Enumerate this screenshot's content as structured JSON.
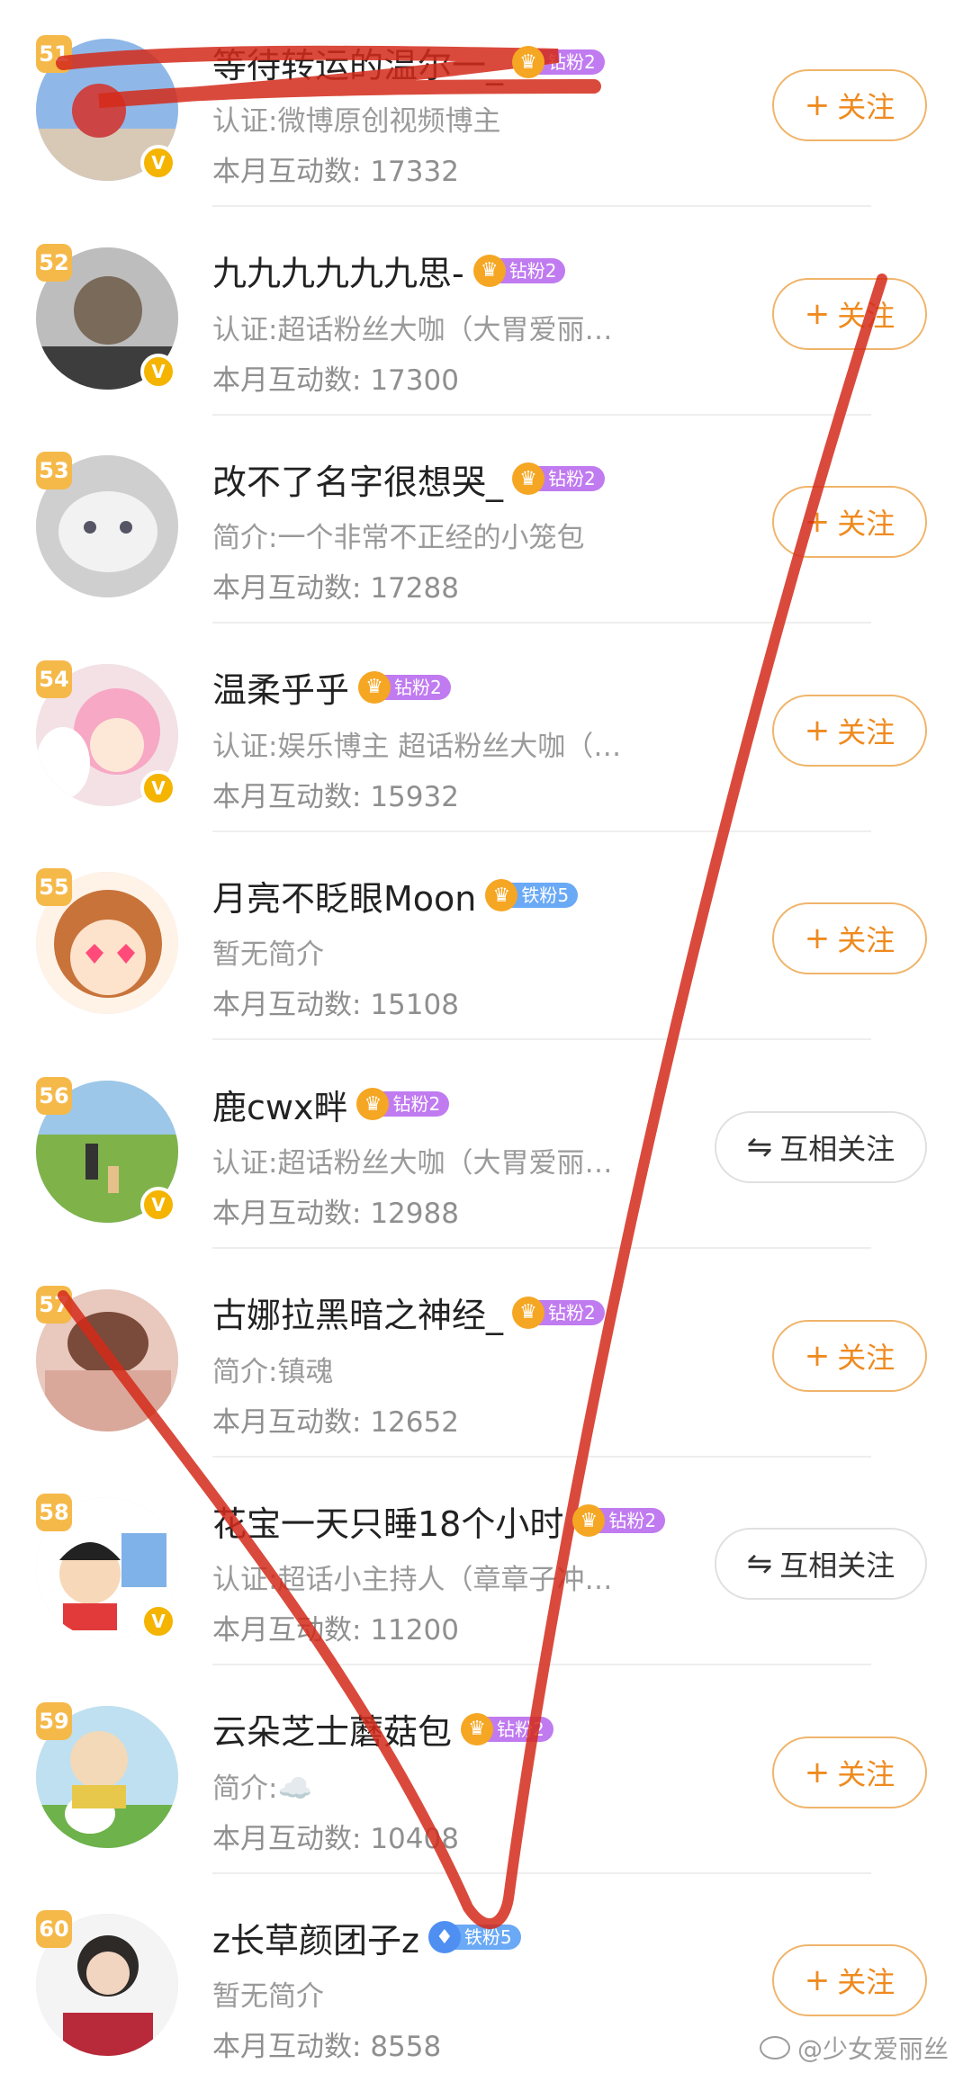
{
  "rows": [
    {
      "rank": "51",
      "name": "等待转运的温尔一_",
      "fan_level": "钻粉2",
      "fan_kind": "diamond",
      "crown": "♛",
      "desc": "认证:微博原创视频博主",
      "count_label": "本月互动数:",
      "count": "17332",
      "button": "关注",
      "button_icon": "+",
      "button_kind": "follow",
      "verified": true,
      "avatar": "sky"
    },
    {
      "rank": "52",
      "name": "九九九九九九思-",
      "fan_level": "钻粉2",
      "fan_kind": "diamond",
      "crown": "♛",
      "desc": "认证:超话粉丝大咖（大胃爱丽…",
      "count_label": "本月互动数:",
      "count": "17300",
      "button": "关注",
      "button_icon": "+",
      "button_kind": "follow",
      "verified": true,
      "avatar": "gray"
    },
    {
      "rank": "53",
      "name": "改不了名字很想哭_",
      "fan_level": "钻粉2",
      "fan_kind": "diamond",
      "crown": "♛",
      "desc": "简介:一个非常不正经的小笼包",
      "count_label": "本月互动数:",
      "count": "17288",
      "button": "关注",
      "button_icon": "+",
      "button_kind": "follow",
      "verified": false,
      "avatar": "cat"
    },
    {
      "rank": "54",
      "name": "温柔乎乎",
      "fan_level": "钻粉2",
      "fan_kind": "diamond",
      "crown": "♛",
      "desc": "认证:娱乐博主 超话粉丝大咖（…",
      "count_label": "本月互动数:",
      "count": "15932",
      "button": "关注",
      "button_icon": "+",
      "button_kind": "follow",
      "verified": true,
      "avatar": "pink"
    },
    {
      "rank": "55",
      "name": "月亮不眨眼Moon",
      "fan_level": "铁粉5",
      "fan_kind": "iron",
      "crown": "♛",
      "desc": "暂无简介",
      "count_label": "本月互动数:",
      "count": "15108",
      "button": "关注",
      "button_icon": "+",
      "button_kind": "follow",
      "verified": false,
      "avatar": "anime"
    },
    {
      "rank": "56",
      "name": "鹿cwx畔",
      "fan_level": "钻粉2",
      "fan_kind": "diamond",
      "crown": "♛",
      "desc": "认证:超话粉丝大咖（大胃爱丽…",
      "count_label": "本月互动数:",
      "count": "12988",
      "button": "互相关注",
      "button_icon": "⇋",
      "button_kind": "mutual",
      "verified": true,
      "avatar": "grass"
    },
    {
      "rank": "57",
      "name": "古娜拉黑暗之神经_",
      "fan_level": "钻粉2",
      "fan_kind": "diamond",
      "crown": "♛",
      "desc": "简介:镇魂",
      "count_label": "本月互动数:",
      "count": "12652",
      "button": "关注",
      "button_icon": "+",
      "button_kind": "follow",
      "verified": false,
      "avatar": "skin"
    },
    {
      "rank": "58",
      "name": "花宝一天只睡18个小时",
      "fan_level": "钻粉2",
      "fan_kind": "diamond",
      "crown": "♛",
      "desc": "认证:超话小主持人（章章子冲…",
      "count_label": "本月互动数:",
      "count": "11200",
      "button": "互相关注",
      "button_icon": "⇋",
      "button_kind": "mutual",
      "verified": true,
      "avatar": "cartoon"
    },
    {
      "rank": "59",
      "name": "云朵芝士蘑菇包",
      "fan_level": "钻粉2",
      "fan_kind": "diamond",
      "crown": "♛",
      "desc": "简介:☁️",
      "count_label": "本月互动数:",
      "count": "10408",
      "button": "关注",
      "button_icon": "+",
      "button_kind": "follow",
      "verified": false,
      "avatar": "snoopy"
    },
    {
      "rank": "60",
      "name": "z长草颜团子z",
      "fan_level": "铁粉5",
      "fan_kind": "iron-blue",
      "crown": "♦",
      "desc": "暂无简介",
      "count_label": "本月互动数:",
      "count": "8558",
      "button": "关注",
      "button_icon": "+",
      "button_kind": "follow",
      "verified": false,
      "avatar": "girl"
    }
  ],
  "watermark": "@少女爱丽丝",
  "colors": {
    "accent": "#ef8a1e",
    "rank_badge": "#f5b94a",
    "scribble": "#d42a1a"
  }
}
